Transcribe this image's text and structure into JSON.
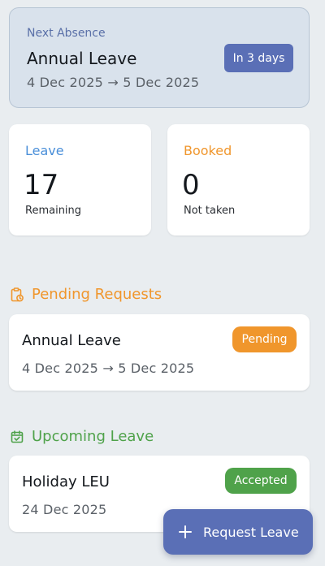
{
  "next_absence": {
    "label": "Next Absence",
    "title": "Annual Leave",
    "date_range": "4 Dec 2025 → 5 Dec 2025",
    "badge": "In 3 days"
  },
  "stats": {
    "leave": {
      "label": "Leave",
      "value": "17",
      "sub": "Remaining",
      "color": "#4a8fd9"
    },
    "booked": {
      "label": "Booked",
      "value": "0",
      "sub": "Not taken",
      "color": "#f0962c"
    }
  },
  "pending": {
    "heading": "Pending Requests",
    "icon": "clipboard-clock-icon",
    "items": [
      {
        "title": "Annual Leave",
        "date": "4 Dec 2025 → 5 Dec 2025",
        "status": "Pending"
      }
    ]
  },
  "upcoming": {
    "heading": "Upcoming Leave",
    "icon": "calendar-check-icon",
    "items": [
      {
        "title": "Holiday LEU",
        "date": "24 Dec 2025",
        "status": "Accepted"
      }
    ]
  },
  "fab": {
    "label": "Request Leave",
    "icon": "plus-icon"
  },
  "colors": {
    "accent": "#5a6fb6",
    "pending": "#f0962c",
    "accepted": "#4fa24a"
  }
}
